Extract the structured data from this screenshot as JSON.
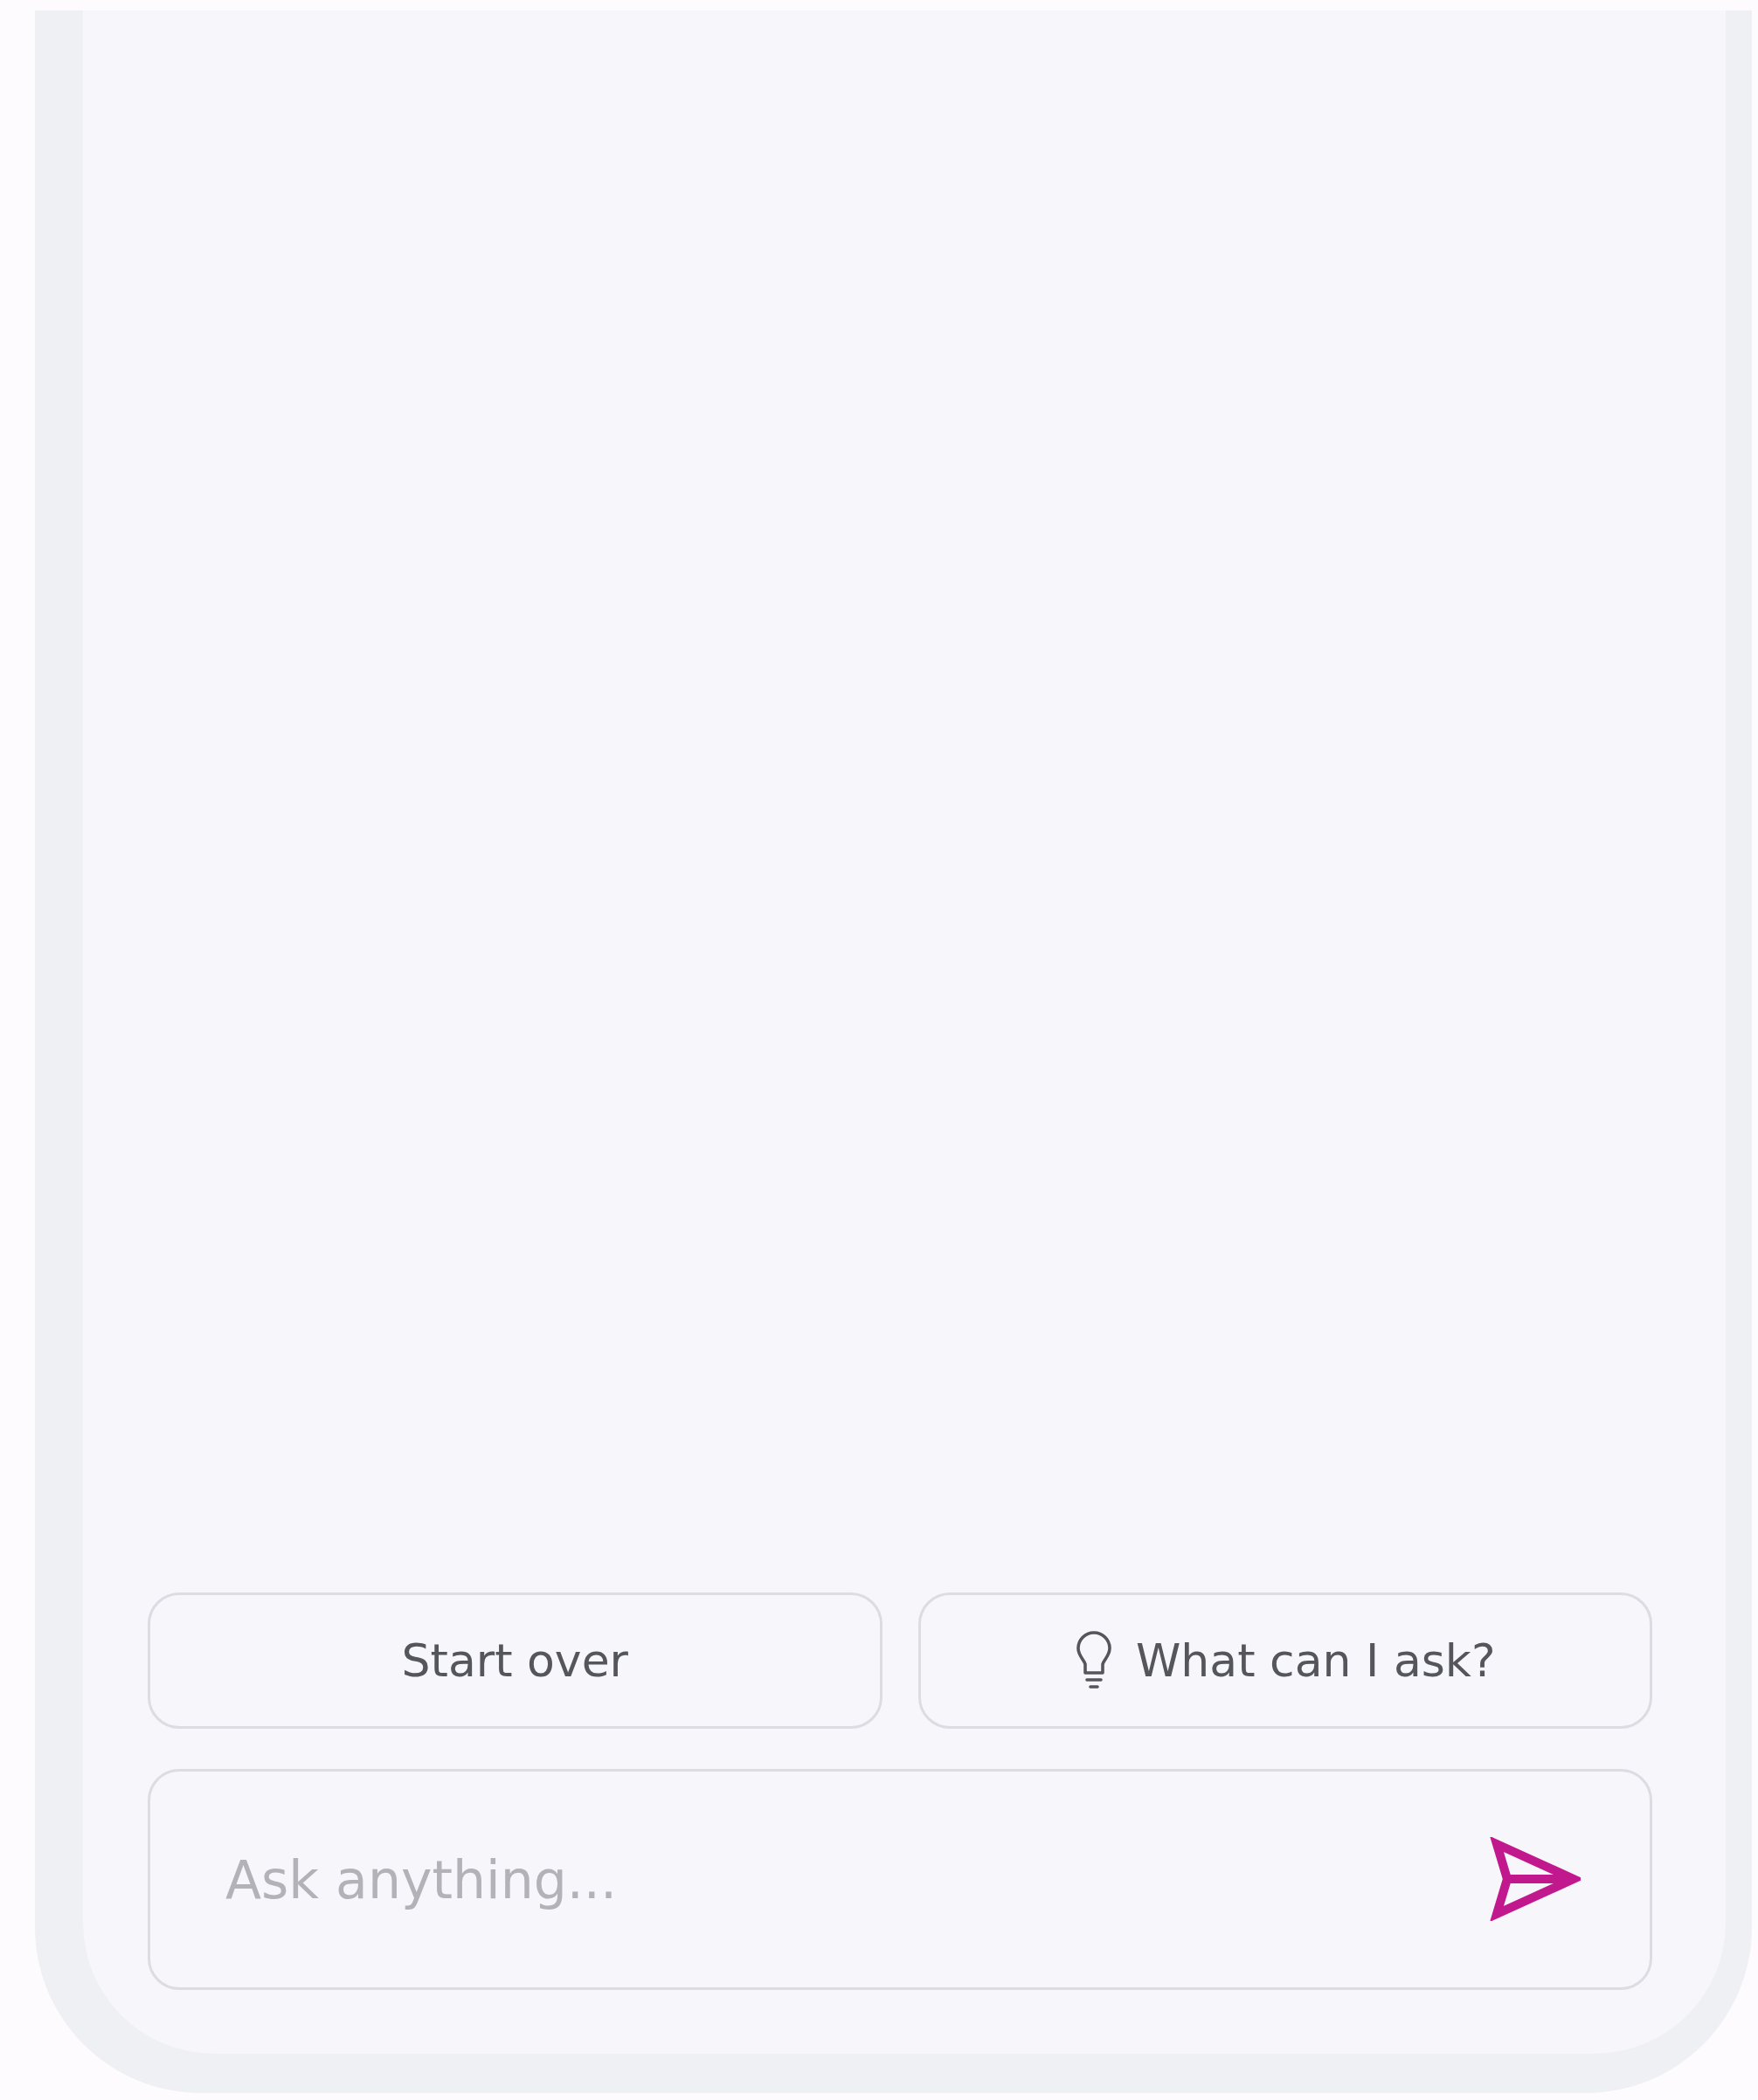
{
  "actions": [
    {
      "label": "Start over",
      "kind": "plain"
    },
    {
      "label": "What can I ask?",
      "kind": "hint"
    }
  ],
  "input": {
    "placeholder": "Ask anything..."
  }
}
